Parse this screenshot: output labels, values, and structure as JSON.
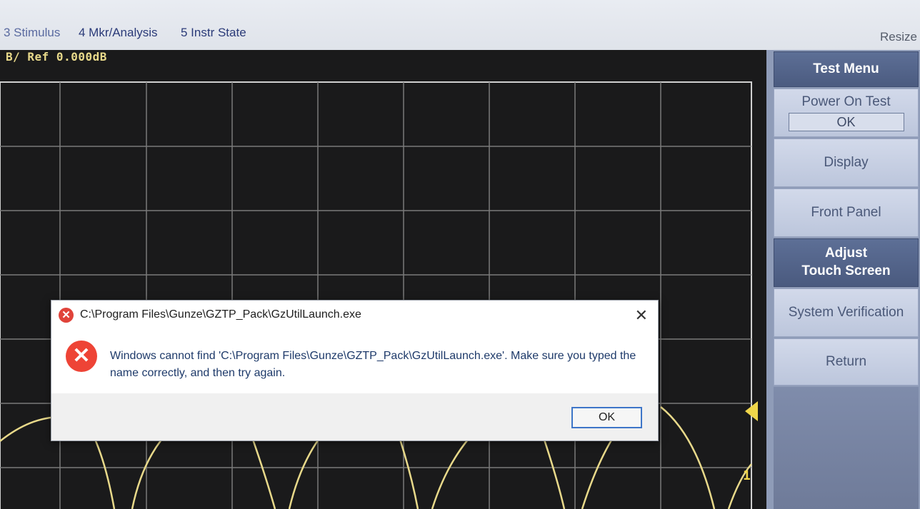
{
  "menu": {
    "items": [
      "3 Stimulus",
      "4 Mkr/Analysis",
      "5 Instr State"
    ],
    "resize_label": "Resize"
  },
  "trace": {
    "scale_ref": "B/ Ref 0.000dB",
    "marker_number": "1"
  },
  "softkeys": {
    "title": "Test Menu",
    "power_on_test_label": "Power On Test",
    "power_on_test_status": "OK",
    "display": "Display",
    "front_panel": "Front Panel",
    "adjust_touch_line1": "Adjust",
    "adjust_touch_line2": "Touch Screen",
    "system_verification": "System Verification",
    "return": "Return"
  },
  "dialog": {
    "title": "C:\\Program Files\\Gunze\\GZTP_Pack\\GzUtilLaunch.exe",
    "close_glyph": "✕",
    "message": "Windows cannot find 'C:\\Program Files\\Gunze\\GZTP_Pack\\GzUtilLaunch.exe'. Make sure you typed the name correctly, and then try again.",
    "ok_label": "OK",
    "error_icon": "error-x-icon"
  },
  "colors": {
    "trace": "#e8d98a",
    "marker": "#f0d64a",
    "softkey_active": "#4b5b80",
    "dialog_ok_border": "#3e76c8"
  }
}
